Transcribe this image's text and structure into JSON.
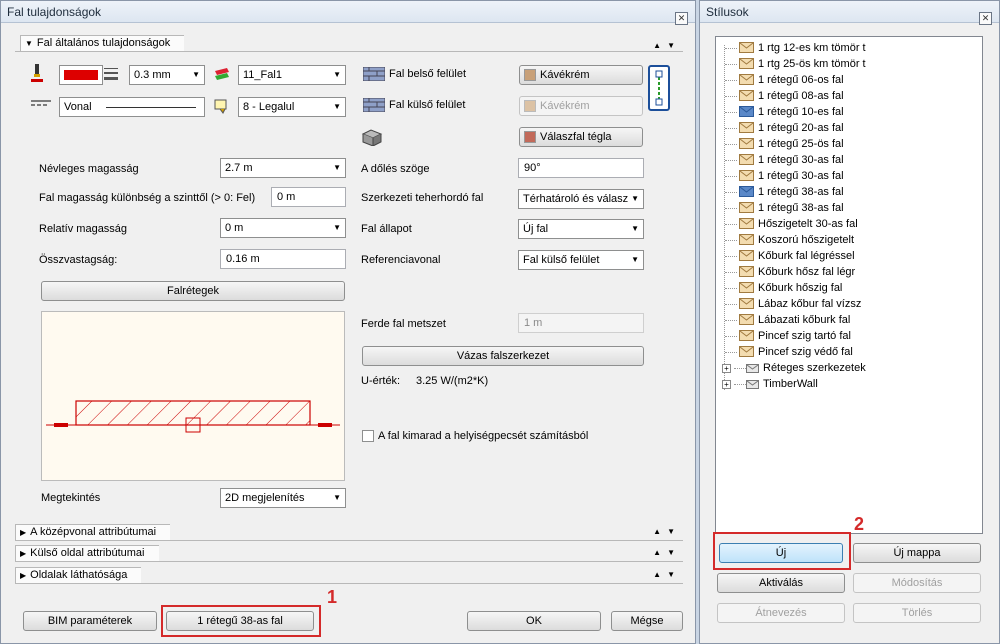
{
  "left_dialog": {
    "title": "Fal tulajdonságok",
    "section_general": "Fal általános tulajdonságok",
    "thickness": "0.3 mm",
    "layer": "11_Fal1",
    "line_type": "Vonal",
    "pen": "8 - Legalul",
    "inner_surface_label": "Fal belső felület",
    "inner_surface_value": "Kávékrém",
    "outer_surface_label": "Fal külső felület",
    "outer_surface_value": "Kávékrém",
    "partition_value": "Válaszfal tégla",
    "nominal_height_label": "Névleges magasság",
    "nominal_height_value": "2.7 m",
    "height_diff_label": "Fal magasság különbség a szinttől (> 0: Fel)",
    "height_diff_value": "0 m",
    "relative_height_label": "Relatív magasság",
    "relative_height_value": "0 m",
    "total_thickness_label": "Összvastagság:",
    "total_thickness_value": "0.16 m",
    "layers_button": "Falrétegek",
    "tilt_label": "A dőlés szöge",
    "tilt_value": "90°",
    "structural_label": "Szerkezeti teherhordó fal",
    "structural_value": "Térhatároló és válasz",
    "state_label": "Fal állapot",
    "state_value": "Új fal",
    "reference_label": "Referenciavonal",
    "reference_value": "Fal külső felület",
    "slanted_label": "Ferde fal metszet",
    "slanted_value": "1 m",
    "skeleton_button": "Vázas falszerkezet",
    "u_value_label": "U-érték:",
    "u_value": "3.25 W/(m2*K)",
    "exclude_label": "A fal kimarad a helyiségpecsét számításból",
    "view_label": "Megtekintés",
    "view_value": "2D megjelenítés",
    "section_centerline": "A középvonal attribútumai",
    "section_outer": "Külső oldal attribútumai",
    "section_sides": "Oldalak láthatósága",
    "bim_button": "BIM paraméterek",
    "style_button": "1 rétegű 38-as fal",
    "ok_button": "OK",
    "cancel_button": "Mégse",
    "annotation_1": "1"
  },
  "right_panel": {
    "title": "Stílusok",
    "items": [
      "1 rtg 12-es km tömör t",
      "1 rtg 25-ös km tömör t",
      "1 rétegű 06-os fal",
      "1 rétegű 08-as fal",
      "1 rétegű 10-es fal",
      "1 rétegű 20-as fal",
      "1 rétegű 25-ös fal",
      "1 rétegű 30-as fal",
      "1 rétegű 30-as fal",
      "1 rétegű 38-as fal",
      "1 rétegű 38-as fal",
      "Hőszigetelt 30-as fal",
      "Koszorú hőszigetelt",
      "Kőburk fal légréssel",
      "Kőburk hősz fal légr",
      "Kőburk hőszig fal",
      "Lábaz kőbur fal vízsz",
      "Lábazati kőburk fal",
      "Pincef szig tartó fal",
      "Pincef szig védő fal"
    ],
    "groups": [
      "Réteges szerkezetek",
      "TimberWall"
    ],
    "new_button": "Új",
    "new_folder_button": "Új mappa",
    "activate_button": "Aktiválás",
    "modify_button": "Módosítás",
    "rename_button": "Átnevezés",
    "delete_button": "Törlés",
    "annotation_2": "2"
  },
  "colors": {
    "annotation_red": "#d42a2a",
    "wall_red": "#cc0000"
  }
}
